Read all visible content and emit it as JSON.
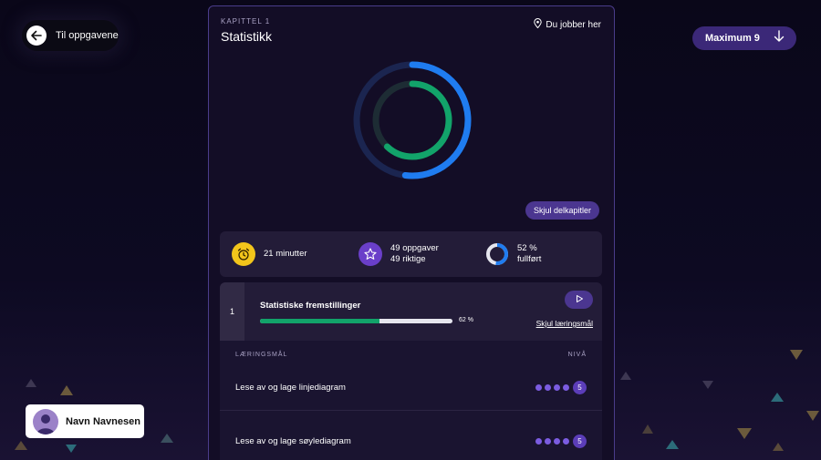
{
  "nav": {
    "back_label": "Til oppgavene",
    "back_icon": "arrow-left-icon",
    "maximum_label": "Maximum 9",
    "maximum_icon": "arrow-down-icon"
  },
  "user": {
    "name": "Navn Navnesen",
    "avatar_icon": "user-avatar-icon"
  },
  "chapter": {
    "kicker": "KAPITTEL 1",
    "title": "Statistikk",
    "location_label": "Du jobber her",
    "location_icon": "map-pin-icon",
    "outer_ring_progress": 0.52,
    "inner_ring_progress": 0.62,
    "hide_subchapters_label": "Skjul delkapitler"
  },
  "stats": {
    "time": {
      "label": "21 minutter",
      "icon": "alarm-clock-icon",
      "color": "#f2c51b"
    },
    "tasks": {
      "line1": "49 oppgaver",
      "line2": "49 riktige",
      "icon": "star-icon",
      "color": "#6a3fc9"
    },
    "completion": {
      "line1": "52 %",
      "line2": "fullført",
      "icon": "donut-progress-icon",
      "progress": 0.52,
      "color": "#1f7cf0"
    }
  },
  "subchapter": {
    "number": "1",
    "title": "Statistiske fremstillinger",
    "progress": 0.62,
    "progress_label": "62 %",
    "play_icon": "play-icon",
    "hide_goals_label": "Skjul læringsmål"
  },
  "goals": {
    "header_left": "LÆRINGSMÅL",
    "header_right": "NIVÅ",
    "items": [
      {
        "label": "Lese av og lage linjediagram",
        "level": "5"
      },
      {
        "label": "Lese av og lage søylediagram",
        "level": "5"
      }
    ]
  },
  "colors": {
    "accent": "#4b3690",
    "outer_ring": "#1f7cf0",
    "inner_ring": "#12a36a",
    "panel_border": "#4a3c8a"
  }
}
